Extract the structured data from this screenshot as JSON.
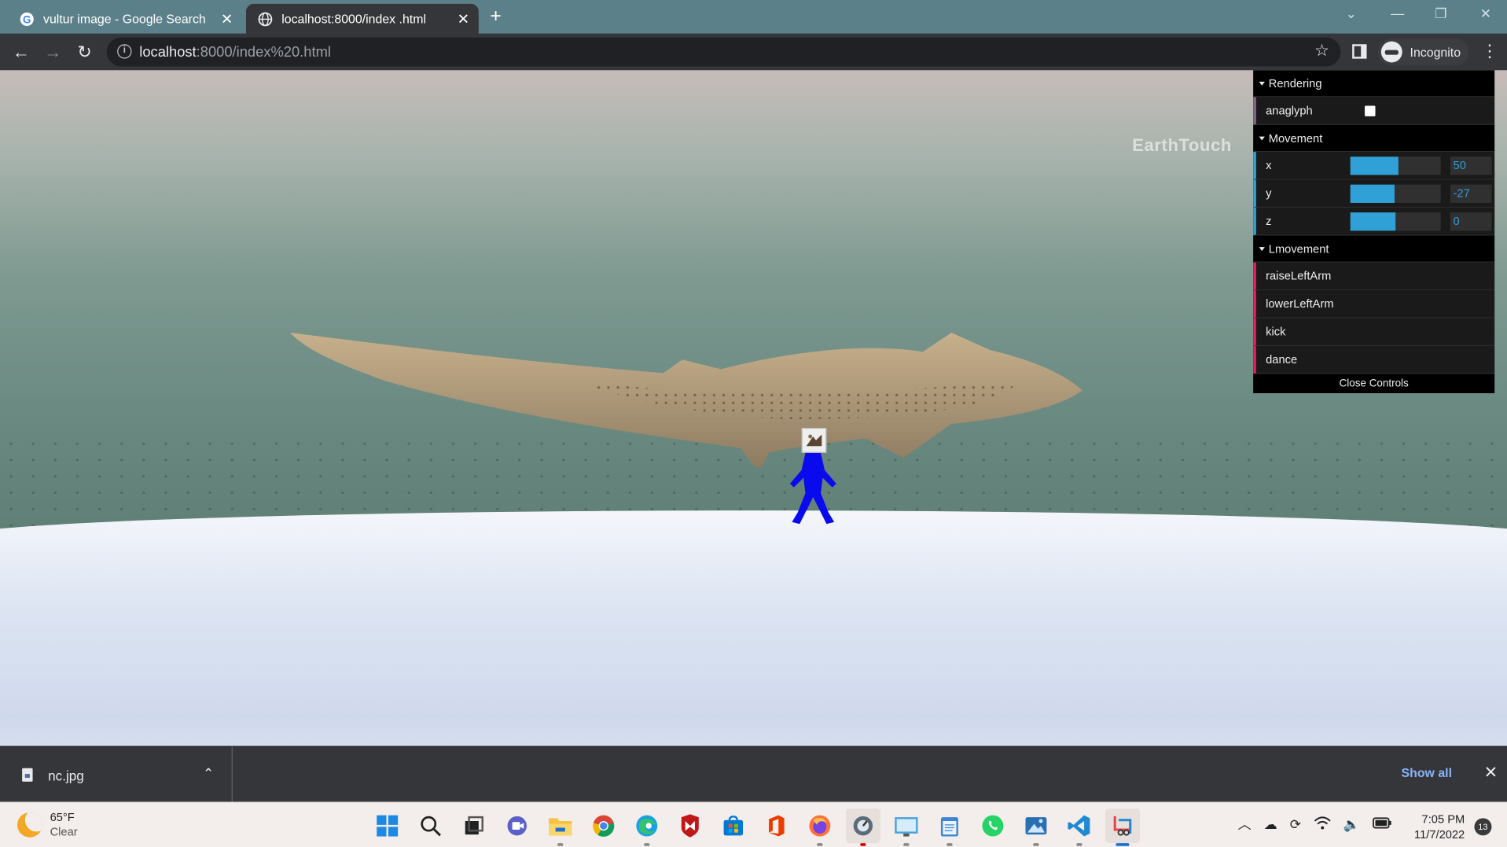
{
  "browser": {
    "tabs": [
      {
        "title": "vultur image - Google Search",
        "favicon": "google-icon",
        "active": false
      },
      {
        "title": "localhost:8000/index .html",
        "favicon": "globe-icon",
        "active": true
      }
    ],
    "url": {
      "host": "localhost",
      "rest": ":8000/index%20.html"
    },
    "profile_label": "Incognito"
  },
  "scene": {
    "watermark": "EarthTouch"
  },
  "gui": {
    "folders": [
      {
        "title": "Rendering",
        "controls": [
          {
            "label": "anaglyph",
            "type": "boolean",
            "value": false
          }
        ]
      },
      {
        "title": "Movement",
        "controls": [
          {
            "label": "x",
            "type": "number",
            "value": "50",
            "fill": 0.53
          },
          {
            "label": "y",
            "type": "number",
            "value": "-27",
            "fill": 0.49
          },
          {
            "label": "z",
            "type": "number",
            "value": "0",
            "fill": 0.5
          }
        ]
      },
      {
        "title": "Lmovement",
        "controls": [
          {
            "label": "raiseLeftArm",
            "type": "function"
          },
          {
            "label": "lowerLeftArm",
            "type": "function"
          },
          {
            "label": "kick",
            "type": "function"
          },
          {
            "label": "dance",
            "type": "function"
          }
        ]
      }
    ],
    "close_label": "Close Controls",
    "colors": {
      "slider": "#2fa1d6",
      "function": "#e61d5f",
      "boolean": "#806787"
    }
  },
  "downloads": {
    "file": "nc.jpg",
    "show_all": "Show all"
  },
  "taskbar": {
    "weather": {
      "temp": "65°F",
      "condition": "Clear"
    },
    "apps": [
      "windows-start-icon",
      "search-icon",
      "task-view-icon",
      "teams-chat-icon",
      "file-explorer-icon",
      "chrome-icon",
      "edge-icon",
      "mcafee-icon",
      "microsoft-store-icon",
      "office-icon",
      "firefox-icon",
      "app-icon",
      "rdp-icon",
      "notepad-icon",
      "whatsapp-icon",
      "photos-icon",
      "vscode-icon",
      "snipping-tool-icon"
    ],
    "clock": {
      "time": "7:05 PM",
      "date": "11/7/2022"
    },
    "notifications": "13"
  }
}
